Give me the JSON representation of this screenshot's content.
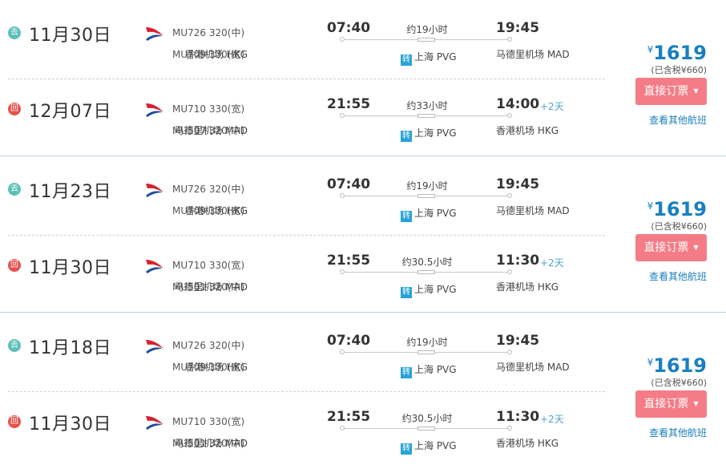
{
  "groups": [
    {
      "outbound": {
        "badge": "去",
        "date": "11月30日",
        "flights": [
          "MU726 320(中)",
          "MU709 330(宽)"
        ],
        "dep_time": "07:40",
        "duration": "约19小时",
        "arr_time": "19:45",
        "arr_plus": "",
        "dep_airport": "香港机场 HKG",
        "transfer": "上海 PVG",
        "arr_airport": "马德里机场 MAD"
      },
      "inbound": {
        "badge": "回",
        "date": "12月07日",
        "flights": [
          "MU710 330(宽)",
          "MU507 320(中)"
        ],
        "dep_time": "21:55",
        "duration": "约33小时",
        "arr_time": "14:00",
        "arr_plus": "+2天",
        "dep_airport": "马德里机场 MAD",
        "transfer": "上海 PVG",
        "arr_airport": "香港机场 HKG"
      },
      "currency": "¥",
      "price": "1619",
      "tax": "(已含税¥660)",
      "book": "直接订票",
      "other": "查看其他航班"
    },
    {
      "outbound": {
        "badge": "去",
        "date": "11月23日",
        "flights": [
          "MU726 320(中)",
          "MU709 330(宽)"
        ],
        "dep_time": "07:40",
        "duration": "约19小时",
        "arr_time": "19:45",
        "arr_plus": "",
        "dep_airport": "香港机场 HKG",
        "transfer": "上海 PVG",
        "arr_airport": "马德里机场 MAD"
      },
      "inbound": {
        "badge": "回",
        "date": "11月30日",
        "flights": [
          "MU710 330(宽)",
          "MU501 320(中)"
        ],
        "dep_time": "21:55",
        "duration": "约30.5小时",
        "arr_time": "11:30",
        "arr_plus": "+2天",
        "dep_airport": "马德里机场 MAD",
        "transfer": "上海 PVG",
        "arr_airport": "香港机场 HKG"
      },
      "currency": "¥",
      "price": "1619",
      "tax": "(已含税¥660)",
      "book": "直接订票",
      "other": "查看其他航班"
    },
    {
      "outbound": {
        "badge": "去",
        "date": "11月18日",
        "flights": [
          "MU726 320(中)",
          "MU709 330(宽)"
        ],
        "dep_time": "07:40",
        "duration": "约19小时",
        "arr_time": "19:45",
        "arr_plus": "",
        "dep_airport": "香港机场 HKG",
        "transfer": "上海 PVG",
        "arr_airport": "马德里机场 MAD"
      },
      "inbound": {
        "badge": "回",
        "date": "11月30日",
        "flights": [
          "MU710 330(宽)",
          "MU501 320(中)"
        ],
        "dep_time": "21:55",
        "duration": "约30.5小时",
        "arr_time": "11:30",
        "arr_plus": "+2天",
        "dep_airport": "马德里机场 MAD",
        "transfer": "上海 PVG",
        "arr_airport": "香港机场 HKG"
      },
      "currency": "¥",
      "price": "1619",
      "tax": "(已含税¥660)",
      "book": "直接订票",
      "other": "查看其他航班"
    }
  ],
  "transfer_icon": "转",
  "colors": {
    "accent_blue": "#1a7fbf",
    "book_button": "#f47c86",
    "go_badge": "#5cc0b8",
    "back_badge": "#e8514d",
    "airline_red": "#d7202f",
    "airline_blue": "#1f4e9c"
  }
}
